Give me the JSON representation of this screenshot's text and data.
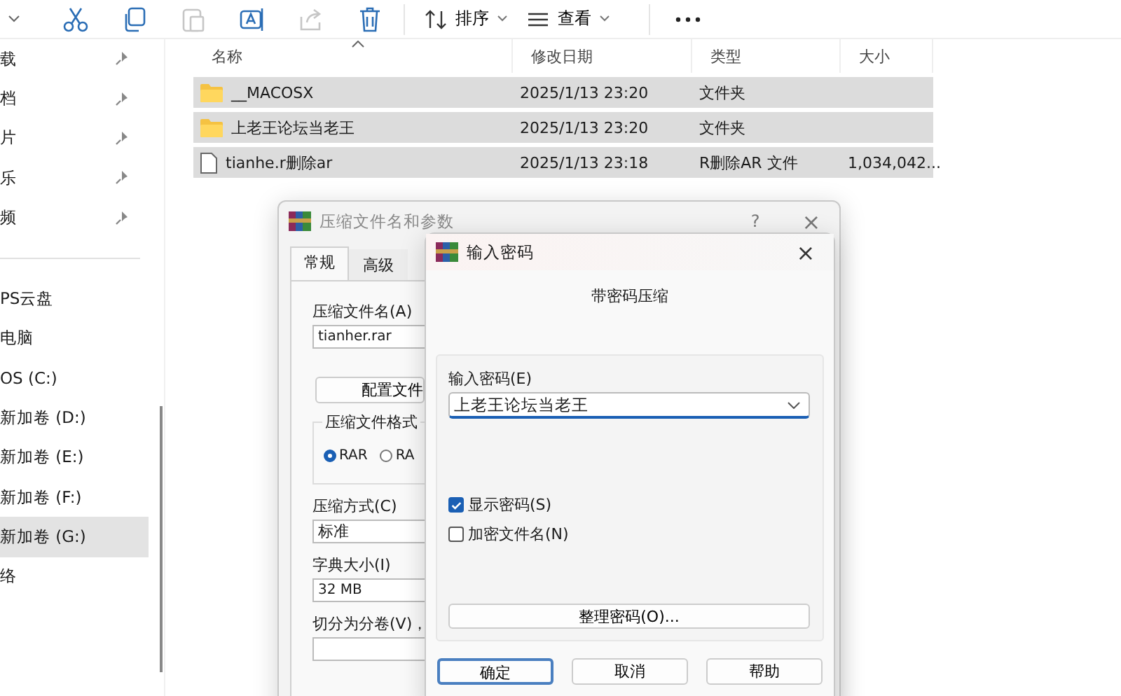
{
  "toolbar": {
    "items": [
      {
        "kind": "cut",
        "disabled": false
      },
      {
        "kind": "copy",
        "disabled": false
      },
      {
        "kind": "paste",
        "disabled": true
      },
      {
        "kind": "rename",
        "disabled": false
      },
      {
        "kind": "share",
        "disabled": true
      },
      {
        "kind": "delete",
        "disabled": false
      }
    ],
    "menus": [
      {
        "kind": "sort",
        "label": "排序"
      },
      {
        "kind": "view",
        "label": "查看"
      }
    ]
  },
  "sidebar": {
    "items": [
      {
        "label": "载",
        "pinned": true,
        "selected": false
      },
      {
        "label": "档",
        "pinned": true,
        "selected": false
      },
      {
        "label": "片",
        "pinned": true,
        "selected": false
      },
      {
        "label": "乐",
        "pinned": true,
        "selected": false
      },
      {
        "label": "频",
        "pinned": true,
        "selected": false
      },
      {
        "kind": "separator"
      },
      {
        "label": "PS云盘",
        "pinned": false,
        "selected": false
      },
      {
        "label": "电脑",
        "pinned": false,
        "selected": false
      },
      {
        "label": "OS (C:)",
        "pinned": false,
        "selected": false
      },
      {
        "label": "新加卷 (D:)",
        "pinned": false,
        "selected": false
      },
      {
        "label": "新加卷 (E:)",
        "pinned": false,
        "selected": false
      },
      {
        "label": "新加卷 (F:)",
        "pinned": false,
        "selected": false
      },
      {
        "label": "新加卷 (G:)",
        "pinned": false,
        "selected": true
      },
      {
        "label": "络",
        "pinned": false,
        "selected": false
      }
    ]
  },
  "file_list": {
    "columns": [
      "名称",
      "修改日期",
      "类型",
      "大小"
    ],
    "rows": [
      {
        "kind": "folder",
        "name": "__MACOSX",
        "date": "2025/1/13 23:20",
        "type": "文件夹",
        "size": "",
        "selected": true
      },
      {
        "kind": "folder",
        "name": "上老王论坛当老王",
        "date": "2025/1/13 23:20",
        "type": "文件夹",
        "size": "",
        "selected": true
      },
      {
        "kind": "file",
        "name": "tianhe.r删除ar",
        "date": "2025/1/13 23:18",
        "type": "R删除AR 文件",
        "size": "1,034,042...",
        "selected": true
      }
    ]
  },
  "archive_dialog": {
    "title": "压缩文件名和参数",
    "help": "?",
    "close": "×",
    "tabs": [
      {
        "label": "常规",
        "selected": true
      },
      {
        "label": "高级",
        "selected": false
      }
    ],
    "archive_name_label": "压缩文件名(A)",
    "archive_name": "tianher.rar",
    "profiles_button": "配置文件",
    "format_group": "压缩文件格式",
    "formats": [
      {
        "label": "RAR",
        "selected": true
      },
      {
        "label": "RA",
        "selected": false
      }
    ],
    "method_label": "压缩方式(C)",
    "method": "标准",
    "dict_label": "字典大小(I)",
    "dict": "32 MB",
    "split_label": "切分为分卷(V)，"
  },
  "password_dialog": {
    "title": "输入密码",
    "close": "×",
    "heading": "带密码压缩",
    "password_label": "输入密码(E)",
    "password": "上老王论坛当老王",
    "options": [
      {
        "label": "显示密码(S)",
        "checked": true
      },
      {
        "label": "加密文件名(N)",
        "checked": false
      }
    ],
    "organize_button": "整理密码(O)...",
    "buttons": [
      {
        "label": "确定",
        "default": true
      },
      {
        "label": "取消",
        "default": false
      },
      {
        "label": "帮助",
        "default": false
      }
    ]
  }
}
